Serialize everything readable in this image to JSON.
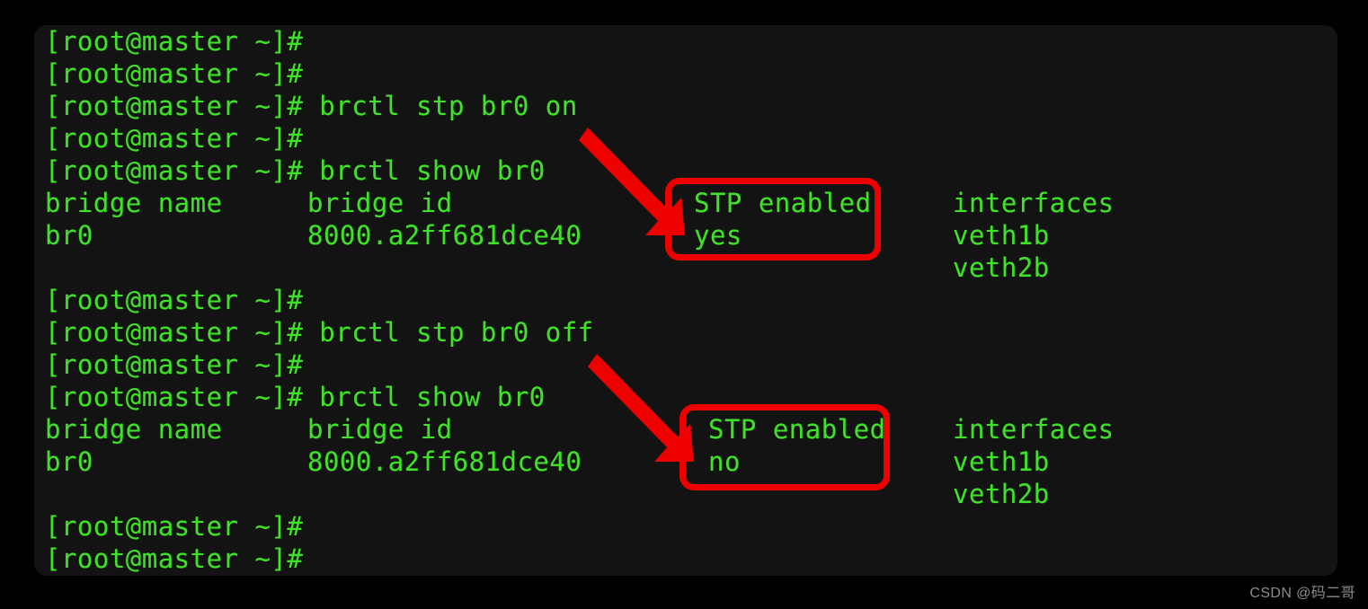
{
  "terminal": {
    "prompt": "[root@master ~]#",
    "bridge_columns": {
      "name_header": "bridge name",
      "id_header": "bridge id",
      "stp_header": "STP enabled",
      "iface_header": "interfaces"
    },
    "lines": [
      {
        "id": "l01",
        "text": "[root@master ~]#"
      },
      {
        "id": "l02",
        "text": "[root@master ~]#"
      },
      {
        "id": "l03",
        "text": "[root@master ~]# brctl stp br0 on"
      },
      {
        "id": "l04",
        "text": "[root@master ~]#"
      },
      {
        "id": "l05",
        "text": "[root@master ~]# brctl show br0"
      },
      {
        "id": "l06",
        "text": "bridge name"
      },
      {
        "id": "l07",
        "text": "br0"
      },
      {
        "id": "l08",
        "text": ""
      },
      {
        "id": "l09",
        "text": "[root@master ~]#"
      },
      {
        "id": "l10",
        "text": "[root@master ~]# brctl stp br0 off"
      },
      {
        "id": "l11",
        "text": "[root@master ~]#"
      },
      {
        "id": "l12",
        "text": "[root@master ~]# brctl show br0"
      },
      {
        "id": "l13",
        "text": "bridge name"
      },
      {
        "id": "l14",
        "text": "br0"
      },
      {
        "id": "l15",
        "text": ""
      },
      {
        "id": "l16",
        "text": "[root@master ~]#"
      },
      {
        "id": "l17",
        "text": "[root@master ~]#"
      }
    ],
    "block_one": {
      "command_stp": "[root@master ~]# brctl stp br0 on",
      "command_show": "[root@master ~]# brctl show br0",
      "bridge_name": "br0",
      "bridge_id": "8000.a2ff681dce40",
      "stp_enabled": "yes",
      "interfaces": [
        "veth1b",
        "veth2b"
      ]
    },
    "block_two": {
      "command_stp": "[root@master ~]# brctl stp br0 off",
      "command_show": "[root@master ~]# brctl show br0",
      "bridge_name": "br0",
      "bridge_id": "8000.a2ff681dce40",
      "stp_enabled": "no",
      "interfaces": [
        "veth1b",
        "veth2b"
      ]
    },
    "cursor": "_"
  },
  "annotations": {
    "highlight_color": "#ee0000",
    "box_one_label": "STP enabled yes",
    "box_two_label": "STP enabled no",
    "arrow_one_label": "arrow pointing to STP enabled yes",
    "arrow_two_label": "arrow pointing to STP enabled no"
  },
  "colors": {
    "terminal_background": "#131313",
    "page_background": "#000000",
    "text_green": "#41e02b",
    "cursor_purple": "#9b1f9b",
    "annotation_red": "#ee0000",
    "watermark_gray": "#8d8d8d"
  },
  "watermark": {
    "text": "CSDN @码二哥"
  }
}
